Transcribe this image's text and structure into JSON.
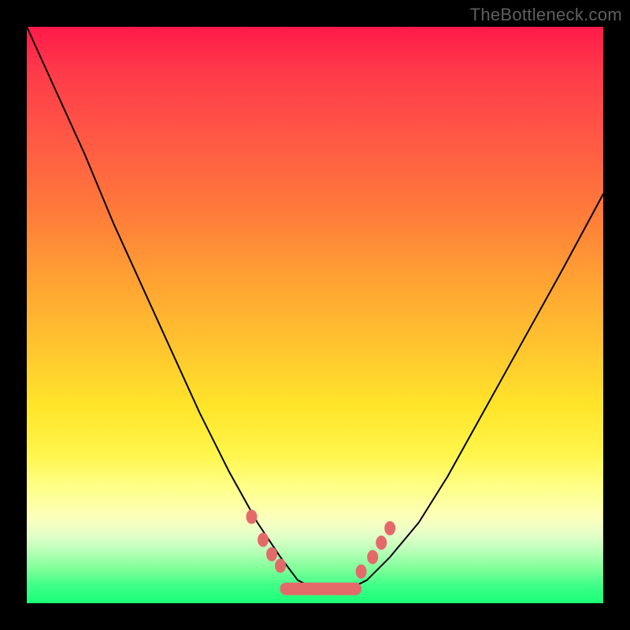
{
  "watermark": "TheBottleneck.com",
  "colors": {
    "frame": "#000000",
    "curve": "#000000",
    "markers": "#e46a6a",
    "gradient_stops": [
      "#ff1a4a",
      "#ff7a3a",
      "#ffe52a",
      "#ffff8a",
      "#1aff77"
    ]
  },
  "chart_data": {
    "type": "line",
    "title": "",
    "xlabel": "",
    "ylabel": "",
    "xlim": [
      0,
      100
    ],
    "ylim": [
      0,
      100
    ],
    "grid": false,
    "legend": false,
    "notes": "V-shaped bottleneck curve on a red→yellow→green vertical gradient. No axis ticks or numeric labels are present; x/y values below are estimated from pixel positions as percentages of the plot area (0 = left/bottom, 100 = right/top).",
    "series": [
      {
        "name": "bottleneck-curve",
        "x": [
          0,
          5,
          10,
          15,
          20,
          25,
          30,
          35,
          40,
          44,
          47,
          50,
          53,
          56,
          59,
          63,
          68,
          73,
          78,
          83,
          88,
          93,
          100
        ],
        "y": [
          100,
          89,
          78,
          66,
          55,
          44,
          33,
          23,
          14,
          8,
          4,
          2.5,
          2.3,
          2.5,
          4,
          8,
          14,
          22,
          31,
          40,
          49,
          58,
          71
        ]
      }
    ],
    "markers": {
      "description": "salmon dot/segment markers near the valley of the curve",
      "points": [
        {
          "x": 39,
          "y": 15
        },
        {
          "x": 41,
          "y": 11
        },
        {
          "x": 42.5,
          "y": 8.5
        },
        {
          "x": 44,
          "y": 6.5
        },
        {
          "x": 58,
          "y": 5.5
        },
        {
          "x": 60,
          "y": 8
        },
        {
          "x": 61.5,
          "y": 10.5
        },
        {
          "x": 63,
          "y": 13
        }
      ],
      "floor_segment": {
        "x_start": 45,
        "x_end": 57,
        "y": 2.5
      }
    }
  }
}
